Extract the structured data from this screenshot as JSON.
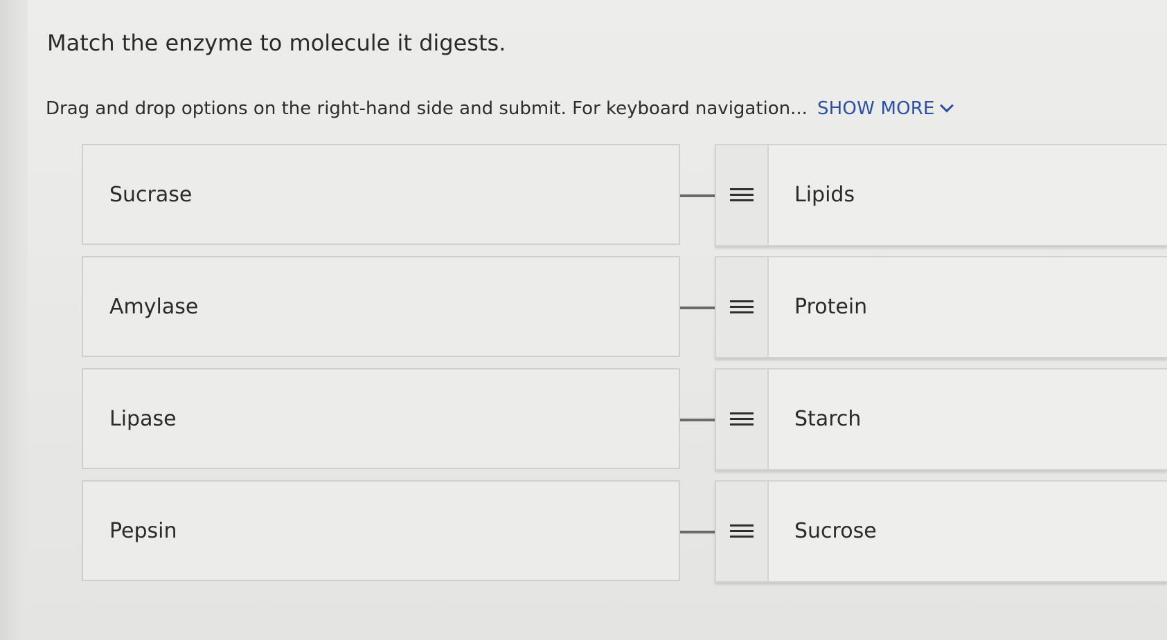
{
  "question": {
    "title": "Match the enzyme to molecule it digests.",
    "instructions": "Drag and drop options on the right-hand side and submit. For keyboard navigation...",
    "show_more_label": "SHOW MORE"
  },
  "terms": [
    {
      "label": "Sucrase"
    },
    {
      "label": "Amylase"
    },
    {
      "label": "Lipase"
    },
    {
      "label": "Pepsin"
    }
  ],
  "options": [
    {
      "label": "Lipids",
      "handle_icon": "drag-handle-icon"
    },
    {
      "label": "Protein",
      "handle_icon": "drag-handle-icon"
    },
    {
      "label": "Starch",
      "handle_icon": "drag-handle-icon"
    },
    {
      "label": "Sucrose",
      "handle_icon": "drag-handle-icon"
    }
  ],
  "colors": {
    "link": "#2b4fa8",
    "text": "#2b2b2b",
    "border": "#cfcfcd"
  }
}
